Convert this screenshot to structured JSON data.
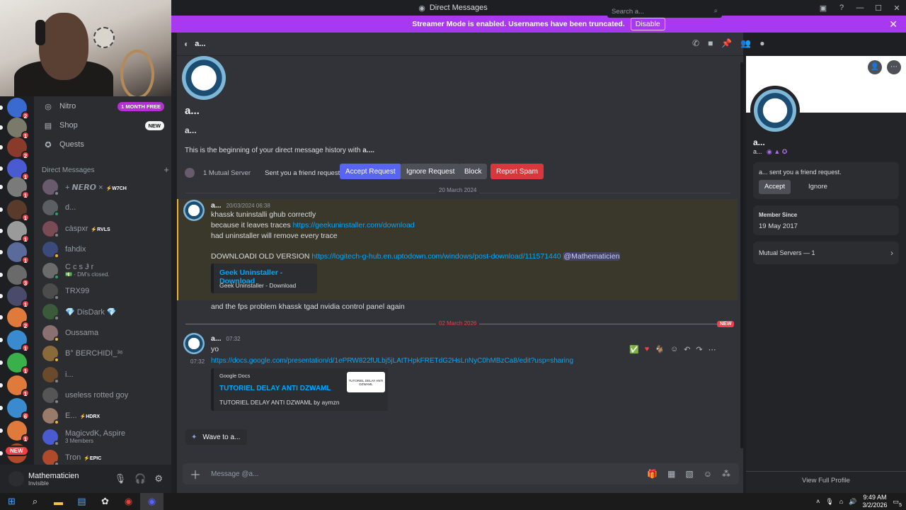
{
  "window": {
    "title": "Direct Messages"
  },
  "banner": {
    "text": "Streamer Mode is enabled. Usernames have been truncated.",
    "button": "Disable"
  },
  "nav": {
    "nitro": {
      "label": "Nitro",
      "tag": "1 MONTH FREE"
    },
    "shop": {
      "label": "Shop",
      "tag": "NEW"
    },
    "quests": {
      "label": "Quests"
    },
    "dm_header": "Direct Messages",
    "dm_add": "+"
  },
  "rail_badges": [
    "2",
    "1",
    "2",
    "1",
    "1",
    "1",
    "1",
    "1",
    "3",
    "1",
    "2",
    "1",
    "1",
    "1",
    "6",
    "1"
  ],
  "rail_new": "NEW",
  "dms": [
    {
      "name": "+ 𝙉𝙀𝙍𝙊 ×",
      "badge": "⚡W7CH",
      "color": "#6a5a6e"
    },
    {
      "name": "d...",
      "badge": "",
      "color": "#5b5f63"
    },
    {
      "name": "càspxr",
      "badge": "⚡RVLS",
      "color": "#7a4a55"
    },
    {
      "name": "fahdix",
      "badge": "",
      "color": "#3a4a7a"
    },
    {
      "name": "C c s Ɉ r",
      "sub": "💵 - DM's closed.",
      "badge": "",
      "color": "#6b6b6b"
    },
    {
      "name": "TRX99",
      "badge": "",
      "color": "#4c4c4c"
    },
    {
      "name": "💎 DisDark 💎",
      "badge": "",
      "color": "#3a5a3a"
    },
    {
      "name": "Oussama",
      "badge": "",
      "color": "#8a7070"
    },
    {
      "name": "B° BERCHIDI_³⁶",
      "badge": "",
      "color": "#8a6a3a"
    },
    {
      "name": "i...",
      "badge": "",
      "color": "#6a4a2a"
    },
    {
      "name": "useless rotted goy",
      "badge": "",
      "color": "#555"
    },
    {
      "name": "E...",
      "badge": "⚡HDRX",
      "color": "#9a7a6a"
    },
    {
      "name": "MagicvdK, Aspire",
      "sub": "3 Members",
      "badge": "",
      "color": "#4a5ad0"
    },
    {
      "name": "Tron",
      "badge": "⚡EPIC",
      "color": "#b04a2a"
    }
  ],
  "user": {
    "name": "Mathematicien",
    "status": "Invisible"
  },
  "header": {
    "name": "a...",
    "search_placeholder": "Search a..."
  },
  "intro": {
    "name_big": "a...",
    "name_small": "a...",
    "history": "This is the beginning of your direct message history with",
    "history_name": "a....",
    "mutual": "1 Mutual Server",
    "request_label": "Sent you a friend request:",
    "accept": "Accept Request",
    "ignore": "Ignore Request",
    "block": "Block",
    "spam": "Report Spam"
  },
  "dividers": {
    "first": "20 March 2024",
    "second": "02 March 2026",
    "new": "NEW"
  },
  "msg1": {
    "author": "a...",
    "time": "20/03/2024 06:38",
    "l1": "khassk tuninstalli ghub correctly",
    "l2": "because it leaves traces",
    "l2_link": "https://geekuninstaller.com/download",
    "l3": "had uninstaller will remove every  trace",
    "l4": "DOWNLOADI OLD VERSION",
    "l4_link": "https://logitech-g-hub.en.uptodown.com/windows/post-download/111571440",
    "mention": "@Mathematicien",
    "embed_title": "Geek Uninstaller - Download",
    "embed_desc": "Geek Uninstaller - Download",
    "l5": "and the fps problem khassk tgad nvidia control panel again"
  },
  "msg2": {
    "author": "a...",
    "time": "07:32",
    "l1": "yo",
    "side_time": "07:32",
    "link": "https://docs.google.com/presentation/d/1ePRW822fULbj5jLAtTHpkFRETdG2HsLnNyC0hMBzCa8/edit?usp=sharing",
    "embed_provider": "Google Docs",
    "embed_title": "TUTORIEL DELAY ANTI DZWAML",
    "embed_desc": "TUTORIEL DELAY ANTI DZWAML by aymzn",
    "thumb_text": "TUTORIEL DELAY ANTI DZWAML"
  },
  "wave": "Wave to a...",
  "composer": {
    "placeholder": "Message @a..."
  },
  "profile": {
    "name": "a...",
    "tag": "a...",
    "request": "a... sent you a friend request.",
    "accept": "Accept",
    "ignore": "Ignore",
    "member_since_label": "Member Since",
    "member_since": "19 May 2017",
    "mutual": "Mutual Servers — 1",
    "full": "View Full Profile"
  },
  "taskbar": {
    "time": "9:49 AM",
    "date": "3/2/2026",
    "notif": "5"
  },
  "colors": {
    "accent": "#5865f2",
    "danger": "#da373c",
    "banner": "#a839f0",
    "link": "#00a8fc"
  }
}
